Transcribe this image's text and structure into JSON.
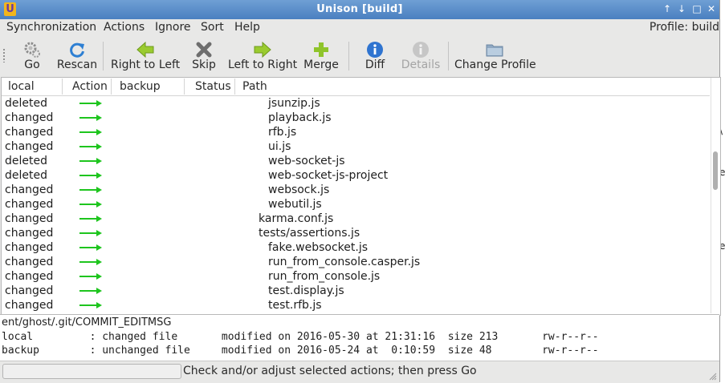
{
  "window": {
    "title": "Unison [build]",
    "controls": {
      "up": "↑",
      "down": "↓",
      "maximize": "□",
      "close": "✕"
    }
  },
  "menu": {
    "items": [
      "Synchronization",
      "Actions",
      "Ignore",
      "Sort",
      "Help"
    ],
    "profile": "Profile: build"
  },
  "toolbar": {
    "buttons": [
      {
        "label": "Go",
        "icon": "gear-icon",
        "enabled": true
      },
      {
        "label": "Rescan",
        "icon": "refresh-icon",
        "enabled": true
      },
      {
        "label": "Right to Left",
        "icon": "arrow-left-icon",
        "enabled": true
      },
      {
        "label": "Skip",
        "icon": "skip-x-icon",
        "enabled": true
      },
      {
        "label": "Left to Right",
        "icon": "arrow-right-icon",
        "enabled": true
      },
      {
        "label": "Merge",
        "icon": "plus-icon",
        "enabled": true
      },
      {
        "label": "Diff",
        "icon": "info-icon",
        "enabled": true
      },
      {
        "label": "Details",
        "icon": "info-icon",
        "enabled": false
      },
      {
        "label": "Change Profile",
        "icon": "folder-icon",
        "enabled": true
      }
    ]
  },
  "columns": [
    "local",
    "Action",
    "backup",
    "Status",
    "Path"
  ],
  "rows": [
    {
      "local": "deleted",
      "path": "jsunzip.js",
      "depth": 2
    },
    {
      "local": "changed",
      "path": "playback.js",
      "depth": 2
    },
    {
      "local": "changed",
      "path": "rfb.js",
      "depth": 2
    },
    {
      "local": "changed",
      "path": "ui.js",
      "depth": 2
    },
    {
      "local": "deleted",
      "path": "web-socket-js",
      "depth": 2
    },
    {
      "local": "deleted",
      "path": "web-socket-js-project",
      "depth": 2
    },
    {
      "local": "changed",
      "path": "websock.js",
      "depth": 2
    },
    {
      "local": "changed",
      "path": "webutil.js",
      "depth": 2
    },
    {
      "local": "changed",
      "path": "karma.conf.js",
      "depth": 1
    },
    {
      "local": "changed",
      "path": "tests/assertions.js",
      "depth": 1
    },
    {
      "local": "changed",
      "path": "fake.websocket.js",
      "depth": 2
    },
    {
      "local": "changed",
      "path": "run_from_console.casper.js",
      "depth": 2
    },
    {
      "local": "changed",
      "path": "run_from_console.js",
      "depth": 2
    },
    {
      "local": "changed",
      "path": "test.display.js",
      "depth": 2
    },
    {
      "local": "changed",
      "path": "test.rfb.js",
      "depth": 2
    }
  ],
  "details": {
    "path": "ent/ghost/.git/COMMIT_EDITMSG",
    "local_line": "local         : changed file       modified on 2016-05-30 at 21:31:16  size 213       rw-r--r--",
    "backup_line": "backup        : unchanged file     modified on 2016-05-24 at  0:10:59  size 48        rw-r--r--"
  },
  "status": {
    "message": "Check and/or adjust selected actions; then press Go"
  },
  "colors": {
    "arrow": "#1ec51e",
    "titlebar": "#5a8ccb"
  }
}
